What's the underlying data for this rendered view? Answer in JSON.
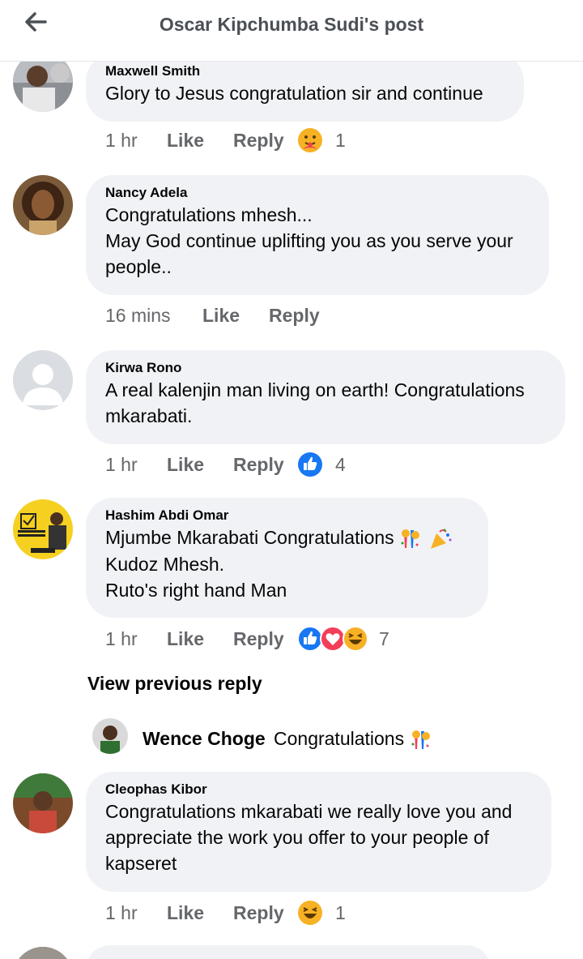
{
  "header": {
    "title": "Oscar Kipchumba Sudi's post",
    "back_icon": "arrow-left-icon"
  },
  "comments": [
    {
      "author": "Maxwell Smith",
      "lines": [
        "Glory to Jesus congratulation sir and continue"
      ],
      "time": "1 hr",
      "like_label": "Like",
      "reply_label": "Reply",
      "reactions": [
        "care"
      ],
      "reaction_count": "1"
    },
    {
      "author": "Nancy Adela",
      "lines": [
        "Congratulations mhesh...",
        "May God continue uplifting you as you serve your",
        "people.."
      ],
      "time": "16 mins",
      "like_label": "Like",
      "reply_label": "Reply",
      "reactions": [],
      "reaction_count": ""
    },
    {
      "author": "Kirwa Rono",
      "lines": [
        "A real kalenjin man living on earth! Congratulations",
        "mkarabati."
      ],
      "time": "1 hr",
      "like_label": "Like",
      "reply_label": "Reply",
      "reactions": [
        "like"
      ],
      "reaction_count": "4"
    },
    {
      "author": "Hashim Abdi Omar",
      "lines": [
        "Mjumbe Mkarabati Congratulations",
        "Kudoz Mhesh.",
        "Ruto's right hand Man"
      ],
      "time": "1 hr",
      "like_label": "Like",
      "reply_label": "Reply",
      "reactions": [
        "like",
        "love",
        "haha"
      ],
      "reaction_count": "7"
    },
    {
      "author": "Cleophas Kibor",
      "lines": [
        "Congratulations mkarabati we really love you and",
        "appreciate the work you offer to your people of",
        "kapseret"
      ],
      "time": "1 hr",
      "like_label": "Like",
      "reply_label": "Reply",
      "reactions": [
        "haha"
      ],
      "reaction_count": "1"
    }
  ],
  "view_previous": "View previous reply",
  "reply": {
    "author": "Wence Choge",
    "text": "Congratulations"
  },
  "colors": {
    "bubble": "#f0f2f5",
    "meta": "#65676b",
    "like_blue": "#1877f2",
    "love_red": "#f33e58",
    "haha_yellow": "#f7b125"
  }
}
